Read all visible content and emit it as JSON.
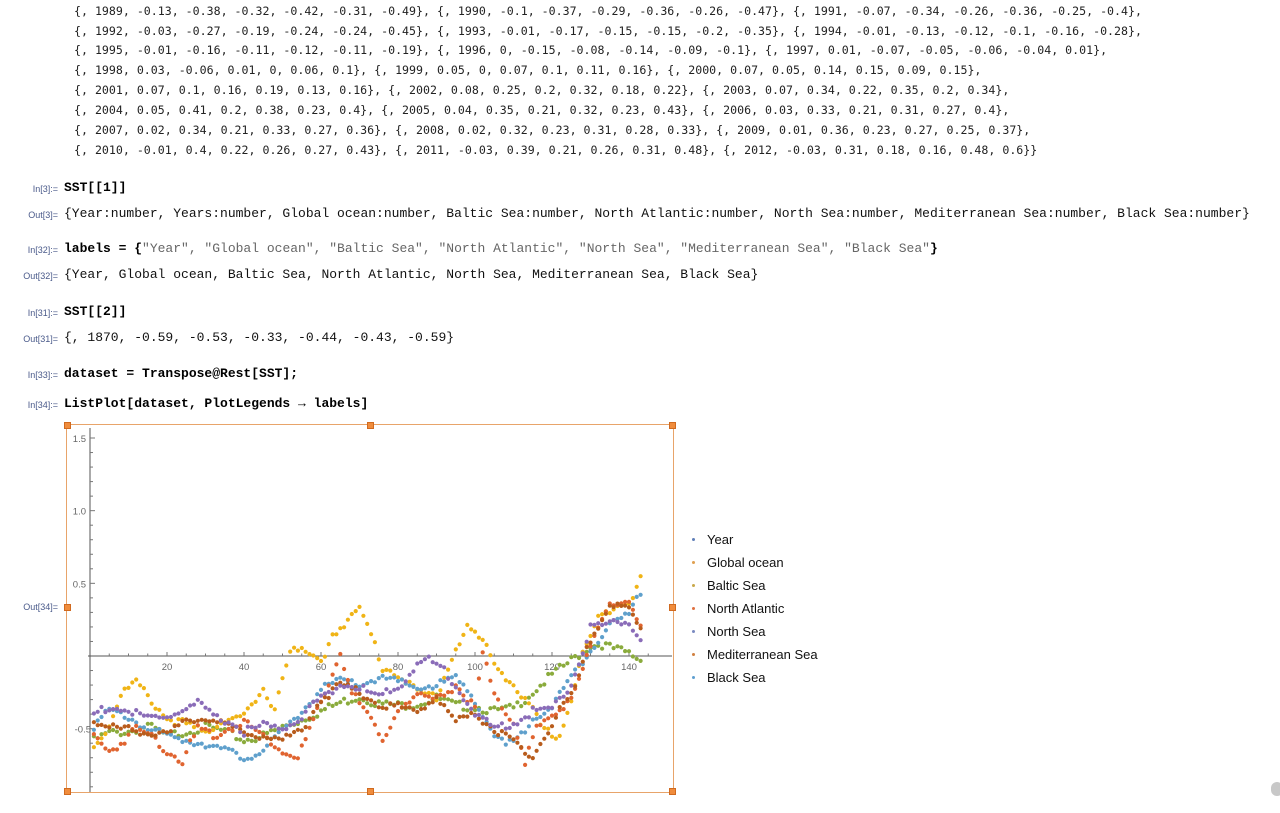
{
  "notebook": {
    "continuation_lines": [
      "{, 1989, -0.13, -0.38, -0.32, -0.42, -0.31, -0.49}, {, 1990, -0.1, -0.37, -0.29, -0.36, -0.26, -0.47}, {, 1991, -0.07, -0.34, -0.26, -0.36, -0.25, -0.4},",
      "{, 1992, -0.03, -0.27, -0.19, -0.24, -0.24, -0.45}, {, 1993, -0.01, -0.17, -0.15, -0.15, -0.2, -0.35}, {, 1994, -0.01, -0.13, -0.12, -0.1, -0.16, -0.28},",
      "{, 1995, -0.01, -0.16, -0.11, -0.12, -0.11, -0.19}, {, 1996, 0, -0.15, -0.08, -0.14, -0.09, -0.1}, {, 1997, 0.01, -0.07, -0.05, -0.06, -0.04, 0.01},",
      "{, 1998, 0.03, -0.06, 0.01, 0, 0.06, 0.1}, {, 1999, 0.05, 0, 0.07, 0.1, 0.11, 0.16}, {, 2000, 0.07, 0.05, 0.14, 0.15, 0.09, 0.15},",
      "{, 2001, 0.07, 0.1, 0.16, 0.19, 0.13, 0.16}, {, 2002, 0.08, 0.25, 0.2, 0.32, 0.18, 0.22}, {, 2003, 0.07, 0.34, 0.22, 0.35, 0.2, 0.34},",
      "{, 2004, 0.05, 0.41, 0.2, 0.38, 0.23, 0.4}, {, 2005, 0.04, 0.35, 0.21, 0.32, 0.23, 0.43}, {, 2006, 0.03, 0.33, 0.21, 0.31, 0.27, 0.4},",
      "{, 2007, 0.02, 0.34, 0.21, 0.33, 0.27, 0.36}, {, 2008, 0.02, 0.32, 0.23, 0.31, 0.28, 0.33}, {, 2009, 0.01, 0.36, 0.23, 0.27, 0.25, 0.37},",
      "{, 2010, -0.01, 0.4, 0.22, 0.26, 0.27, 0.43}, {, 2011, -0.03, 0.39, 0.21, 0.26, 0.31, 0.48}, {, 2012, -0.03, 0.31, 0.18, 0.16, 0.48, 0.6}}"
    ],
    "cells": [
      {
        "in_label": "In[3]:=",
        "input": "SST[[1]]",
        "out_label": "Out[3]=",
        "output": "{Year:number, Years:number, Global ocean:number, Baltic Sea:number, North Atlantic:number, North Sea:number, Mediterranean Sea:number, Black Sea:number}"
      },
      {
        "in_label": "In[32]:=",
        "input_prefix": "labels = {",
        "input_strings": "\"Year\", \"Global ocean\", \"Baltic Sea\", \"North Atlantic\", \"North Sea\", \"Mediterranean Sea\", \"Black Sea\"",
        "input_suffix": "}",
        "out_label": "Out[32]=",
        "output": "{Year, Global ocean, Baltic Sea, North Atlantic, North Sea, Mediterranean Sea, Black Sea}"
      },
      {
        "in_label": "In[31]:=",
        "input": "SST[[2]]",
        "out_label": "Out[31]=",
        "output": "{, 1870, -0.59, -0.53, -0.33, -0.44, -0.43, -0.59}"
      },
      {
        "in_label": "In[33]:=",
        "input": "dataset = Transpose@Rest[SST];"
      },
      {
        "in_label": "In[34]:=",
        "input": "ListPlot[dataset, PlotLegends → labels]",
        "out_label": "Out[34]="
      }
    ]
  },
  "chart_data": {
    "type": "scatter",
    "title": "",
    "xlabel": "",
    "ylabel": "",
    "xlim": [
      0,
      147
    ],
    "ylim": [
      -1.0,
      1.55
    ],
    "x_ticks": [
      20,
      40,
      60,
      80,
      100,
      120,
      140
    ],
    "y_ticks": [
      -0.5,
      0.5,
      1.0,
      1.5
    ],
    "y_tick_labels": [
      "-0.5",
      "0.5",
      "1.0",
      "1.5"
    ],
    "legend_position": "right",
    "legend": [
      "Year",
      "Global ocean",
      "Baltic Sea",
      "North Atlantic",
      "North Sea",
      "Mediterranean Sea",
      "Black Sea"
    ],
    "series": [
      {
        "name": "Global ocean",
        "color": "#8aab3c",
        "anchors": [
          [
            1,
            -0.58
          ],
          [
            5,
            -0.53
          ],
          [
            10,
            -0.52
          ],
          [
            15,
            -0.48
          ],
          [
            20,
            -0.55
          ],
          [
            25,
            -0.52
          ],
          [
            30,
            -0.49
          ],
          [
            35,
            -0.52
          ],
          [
            40,
            -0.58
          ],
          [
            45,
            -0.55
          ],
          [
            50,
            -0.49
          ],
          [
            55,
            -0.44
          ],
          [
            60,
            -0.38
          ],
          [
            65,
            -0.32
          ],
          [
            70,
            -0.28
          ],
          [
            75,
            -0.33
          ],
          [
            80,
            -0.34
          ],
          [
            85,
            -0.33
          ],
          [
            90,
            -0.29
          ],
          [
            95,
            -0.34
          ],
          [
            100,
            -0.35
          ],
          [
            105,
            -0.38
          ],
          [
            110,
            -0.36
          ],
          [
            115,
            -0.25
          ],
          [
            120,
            -0.13
          ],
          [
            125,
            -0.03
          ],
          [
            130,
            0.07
          ],
          [
            133,
            0.08
          ],
          [
            136,
            0.05
          ],
          [
            140,
            0.02
          ],
          [
            143,
            -0.03
          ]
        ]
      },
      {
        "name": "Baltic Sea",
        "color": "#f0b416",
        "anchors": [
          [
            1,
            -0.62
          ],
          [
            5,
            -0.48
          ],
          [
            8,
            -0.26
          ],
          [
            12,
            -0.18
          ],
          [
            15,
            -0.28
          ],
          [
            20,
            -0.43
          ],
          [
            25,
            -0.47
          ],
          [
            30,
            -0.53
          ],
          [
            35,
            -0.43
          ],
          [
            40,
            -0.42
          ],
          [
            45,
            -0.25
          ],
          [
            48,
            -0.35
          ],
          [
            52,
            0.05
          ],
          [
            56,
            0.02
          ],
          [
            60,
            -0.05
          ],
          [
            63,
            0.15
          ],
          [
            67,
            0.25
          ],
          [
            70,
            0.32
          ],
          [
            73,
            0.15
          ],
          [
            76,
            -0.08
          ],
          [
            80,
            -0.12
          ],
          [
            85,
            -0.25
          ],
          [
            90,
            -0.28
          ],
          [
            95,
            0.05
          ],
          [
            98,
            0.2
          ],
          [
            102,
            0.1
          ],
          [
            105,
            -0.05
          ],
          [
            110,
            -0.2
          ],
          [
            115,
            -0.38
          ],
          [
            118,
            -0.52
          ],
          [
            122,
            -0.55
          ],
          [
            125,
            -0.3
          ],
          [
            128,
            0.02
          ],
          [
            132,
            0.25
          ],
          [
            136,
            0.35
          ],
          [
            140,
            0.38
          ],
          [
            143,
            0.52
          ]
        ]
      },
      {
        "name": "North Atlantic",
        "color": "#5fa0cc",
        "anchors": [
          [
            1,
            -0.48
          ],
          [
            5,
            -0.38
          ],
          [
            10,
            -0.42
          ],
          [
            15,
            -0.5
          ],
          [
            20,
            -0.55
          ],
          [
            25,
            -0.58
          ],
          [
            30,
            -0.6
          ],
          [
            35,
            -0.65
          ],
          [
            40,
            -0.7
          ],
          [
            45,
            -0.65
          ],
          [
            50,
            -0.52
          ],
          [
            55,
            -0.38
          ],
          [
            60,
            -0.23
          ],
          [
            65,
            -0.17
          ],
          [
            70,
            -0.2
          ],
          [
            75,
            -0.15
          ],
          [
            80,
            -0.18
          ],
          [
            85,
            -0.22
          ],
          [
            90,
            -0.2
          ],
          [
            95,
            -0.15
          ],
          [
            100,
            -0.3
          ],
          [
            105,
            -0.55
          ],
          [
            108,
            -0.62
          ],
          [
            112,
            -0.55
          ],
          [
            115,
            -0.42
          ],
          [
            120,
            -0.35
          ],
          [
            125,
            -0.15
          ],
          [
            130,
            0.05
          ],
          [
            135,
            0.22
          ],
          [
            140,
            0.28
          ],
          [
            143,
            0.45
          ]
        ]
      },
      {
        "name": "North Sea",
        "color": "#e06430",
        "anchors": [
          [
            1,
            -0.55
          ],
          [
            5,
            -0.65
          ],
          [
            8,
            -0.6
          ],
          [
            12,
            -0.5
          ],
          [
            16,
            -0.55
          ],
          [
            20,
            -0.65
          ],
          [
            24,
            -0.72
          ],
          [
            28,
            -0.5
          ],
          [
            32,
            -0.55
          ],
          [
            36,
            -0.5
          ],
          [
            40,
            -0.45
          ],
          [
            45,
            -0.55
          ],
          [
            50,
            -0.65
          ],
          [
            54,
            -0.7
          ],
          [
            58,
            -0.45
          ],
          [
            62,
            -0.2
          ],
          [
            65,
            0.02
          ],
          [
            68,
            -0.25
          ],
          [
            72,
            -0.4
          ],
          [
            76,
            -0.6
          ],
          [
            80,
            -0.35
          ],
          [
            85,
            -0.28
          ],
          [
            90,
            -0.3
          ],
          [
            95,
            -0.2
          ],
          [
            100,
            -0.35
          ],
          [
            102,
            0.02
          ],
          [
            105,
            -0.28
          ],
          [
            110,
            -0.45
          ],
          [
            113,
            -0.72
          ],
          [
            116,
            -0.5
          ],
          [
            120,
            -0.42
          ],
          [
            125,
            -0.28
          ],
          [
            130,
            0.05
          ],
          [
            135,
            0.35
          ],
          [
            140,
            0.38
          ],
          [
            143,
            0.22
          ]
        ]
      },
      {
        "name": "Mediterranean Sea",
        "color": "#b85c1c",
        "anchors": [
          [
            1,
            -0.45
          ],
          [
            5,
            -0.5
          ],
          [
            10,
            -0.5
          ],
          [
            15,
            -0.52
          ],
          [
            20,
            -0.55
          ],
          [
            25,
            -0.45
          ],
          [
            30,
            -0.42
          ],
          [
            35,
            -0.48
          ],
          [
            40,
            -0.52
          ],
          [
            45,
            -0.55
          ],
          [
            50,
            -0.58
          ],
          [
            55,
            -0.5
          ],
          [
            60,
            -0.3
          ],
          [
            65,
            -0.2
          ],
          [
            70,
            -0.25
          ],
          [
            75,
            -0.33
          ],
          [
            80,
            -0.35
          ],
          [
            85,
            -0.38
          ],
          [
            90,
            -0.28
          ],
          [
            95,
            -0.45
          ],
          [
            100,
            -0.4
          ],
          [
            105,
            -0.5
          ],
          [
            108,
            -0.55
          ],
          [
            112,
            -0.65
          ],
          [
            114,
            -0.72
          ],
          [
            118,
            -0.55
          ],
          [
            122,
            -0.38
          ],
          [
            126,
            -0.22
          ],
          [
            130,
            0.12
          ],
          [
            135,
            0.35
          ],
          [
            140,
            0.32
          ],
          [
            143,
            0.18
          ]
        ]
      },
      {
        "name": "Black Sea",
        "color": "#8a6cb8",
        "anchors": [
          [
            1,
            -0.4
          ],
          [
            5,
            -0.35
          ],
          [
            10,
            -0.38
          ],
          [
            15,
            -0.43
          ],
          [
            20,
            -0.42
          ],
          [
            25,
            -0.36
          ],
          [
            28,
            -0.33
          ],
          [
            32,
            -0.42
          ],
          [
            36,
            -0.45
          ],
          [
            40,
            -0.52
          ],
          [
            45,
            -0.48
          ],
          [
            50,
            -0.5
          ],
          [
            55,
            -0.42
          ],
          [
            60,
            -0.28
          ],
          [
            65,
            -0.2
          ],
          [
            70,
            -0.22
          ],
          [
            75,
            -0.28
          ],
          [
            80,
            -0.22
          ],
          [
            85,
            -0.05
          ],
          [
            88,
            -0.03
          ],
          [
            92,
            -0.1
          ],
          [
            95,
            -0.2
          ],
          [
            100,
            -0.4
          ],
          [
            105,
            -0.5
          ],
          [
            110,
            -0.46
          ],
          [
            115,
            -0.38
          ],
          [
            120,
            -0.36
          ],
          [
            125,
            -0.2
          ],
          [
            130,
            0.2
          ],
          [
            135,
            0.22
          ],
          [
            140,
            0.24
          ],
          [
            143,
            0.12
          ]
        ]
      }
    ]
  },
  "icons": {
    "scroll_handle": "scroll-icon"
  }
}
